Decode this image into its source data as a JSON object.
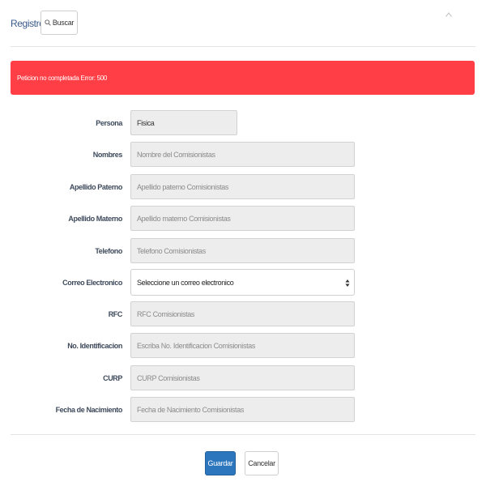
{
  "header": {
    "title": "Registro",
    "search_label": "Buscar"
  },
  "alert": {
    "message": "Peticion no completada Error: 500",
    "color": "#ff3e45"
  },
  "form": {
    "fields": [
      {
        "label": "Persona",
        "value": "Fisica",
        "placeholder": ""
      },
      {
        "label": "Nombres",
        "value": "",
        "placeholder": "Nombre del Comisionistas"
      },
      {
        "label": "Apellido Paterno",
        "value": "",
        "placeholder": "Apellido paterno Comisionistas"
      },
      {
        "label": "Apellido Materno",
        "value": "",
        "placeholder": "Apellido materno Comisionistas"
      },
      {
        "label": "Telefono",
        "value": "",
        "placeholder": "Telefono Comisionistas"
      },
      {
        "label": "Correo Electronico",
        "value": "Seleccione un correo electronico",
        "placeholder": ""
      },
      {
        "label": "RFC",
        "value": "",
        "placeholder": "RFC Comisionistas"
      },
      {
        "label": "No. Identificacion",
        "value": "",
        "placeholder": "Escriba No. Identificacion Comisionistas"
      },
      {
        "label": "CURP",
        "value": "",
        "placeholder": "CURP Comisionistas"
      },
      {
        "label": "Fecha de Nacimiento",
        "value": "",
        "placeholder": "Fecha de Nacimiento Comisionistas"
      }
    ]
  },
  "footer": {
    "save_label": "Guardar",
    "cancel_label": "Cancelar",
    "primary_color": "#2c76be"
  },
  "icons": {
    "search": "search-icon",
    "collapse": "chevron-up-icon",
    "select": "select-arrows-icon"
  }
}
